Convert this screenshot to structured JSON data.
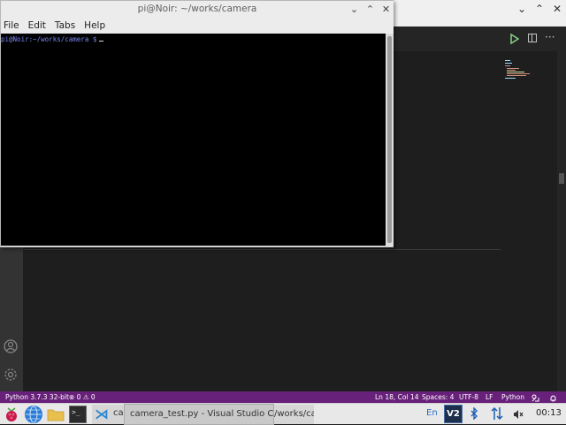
{
  "terminal": {
    "title": "pi@Noir: ~/works/camera",
    "menus": [
      "File",
      "Edit",
      "Tabs",
      "Help"
    ],
    "prompt": "pi@Noir:~/works/camera $",
    "controls": {
      "minimize": "⌄",
      "maximize": "⌃",
      "close": "✕"
    }
  },
  "vscode": {
    "controls": {
      "minimize": "⌄",
      "maximize": "⌃",
      "close": "✕"
    },
    "toolbar": {
      "more": "···"
    },
    "statusbar": {
      "python_version": "Python 3.7.3 32-bit",
      "problems": "⊗ 0 ⚠ 0",
      "position": "Ln 18, Col 14",
      "spaces": "Spaces: 4",
      "encoding": "UTF-8",
      "eol": "LF",
      "language": "Python"
    }
  },
  "taskbar": {
    "vscode_task_label": "car",
    "tooltip": "camera_test.py - Visual Studio Code",
    "terminal_task_label": "/works/ca...",
    "language": "En",
    "vnc_label": "V2",
    "clock": "00:13"
  },
  "colors": {
    "statusbar": "#68217a",
    "editor_bg": "#1e1e1e",
    "terminal_bg": "#000000",
    "prompt": "#7a86f0"
  }
}
